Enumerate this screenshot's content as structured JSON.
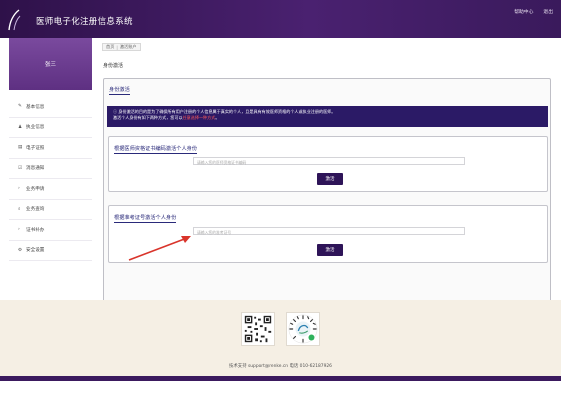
{
  "header": {
    "title": "医师电子化注册信息系统",
    "links": [
      "帮助中心",
      "退出"
    ]
  },
  "sidebar": {
    "user_name": "张三",
    "items": [
      {
        "icon": "edit-icon",
        "glyph": "✎",
        "label": "基本信息"
      },
      {
        "icon": "users-icon",
        "glyph": "♟",
        "label": "执业信息"
      },
      {
        "icon": "card-icon",
        "glyph": "▤",
        "label": "电子证照"
      },
      {
        "icon": "check-icon",
        "glyph": "☑",
        "label": "消息通知"
      },
      {
        "icon": "chevron-right-icon",
        "glyph": "›",
        "label": "业务申请"
      },
      {
        "icon": "search-icon",
        "glyph": "⌕",
        "label": "业务查询"
      },
      {
        "icon": "chevron-right-icon",
        "glyph": "›",
        "label": "证书补办"
      },
      {
        "icon": "gear-icon",
        "glyph": "⚙",
        "label": "安全设置"
      }
    ]
  },
  "breadcrumb": {
    "home": "首页",
    "current": "激活账户"
  },
  "page": {
    "heading": "身份激活",
    "panel_title": "身份激活",
    "notice_line1": "身份激活的目的是为了确保所有用户注册的个人信息属于真实的个人，且是具有有效医师资格的个人或执业注册的医师。",
    "notice_line2_prefix": "激活个人身份有如下两种方式，您可以",
    "notice_line2_highlight": "任意选择一种方式",
    "notice_line2_suffix": "。",
    "method1": {
      "title": "根据医师资格证书编码激活个人身份",
      "placeholder": "请输入您的医师资格证书编码",
      "button": "激活"
    },
    "method2": {
      "title": "根据准考证号激活个人身份",
      "placeholder": "请输入您的准考证号",
      "button": "激活"
    }
  },
  "footer": {
    "support": "技术支持 support@renke.cn 电话 010-62187926"
  },
  "colors": {
    "header": "#3b1a5e",
    "accent": "#2e1458",
    "highlight": "#ff5a5a",
    "annotation_arrow": "#d9342b"
  }
}
